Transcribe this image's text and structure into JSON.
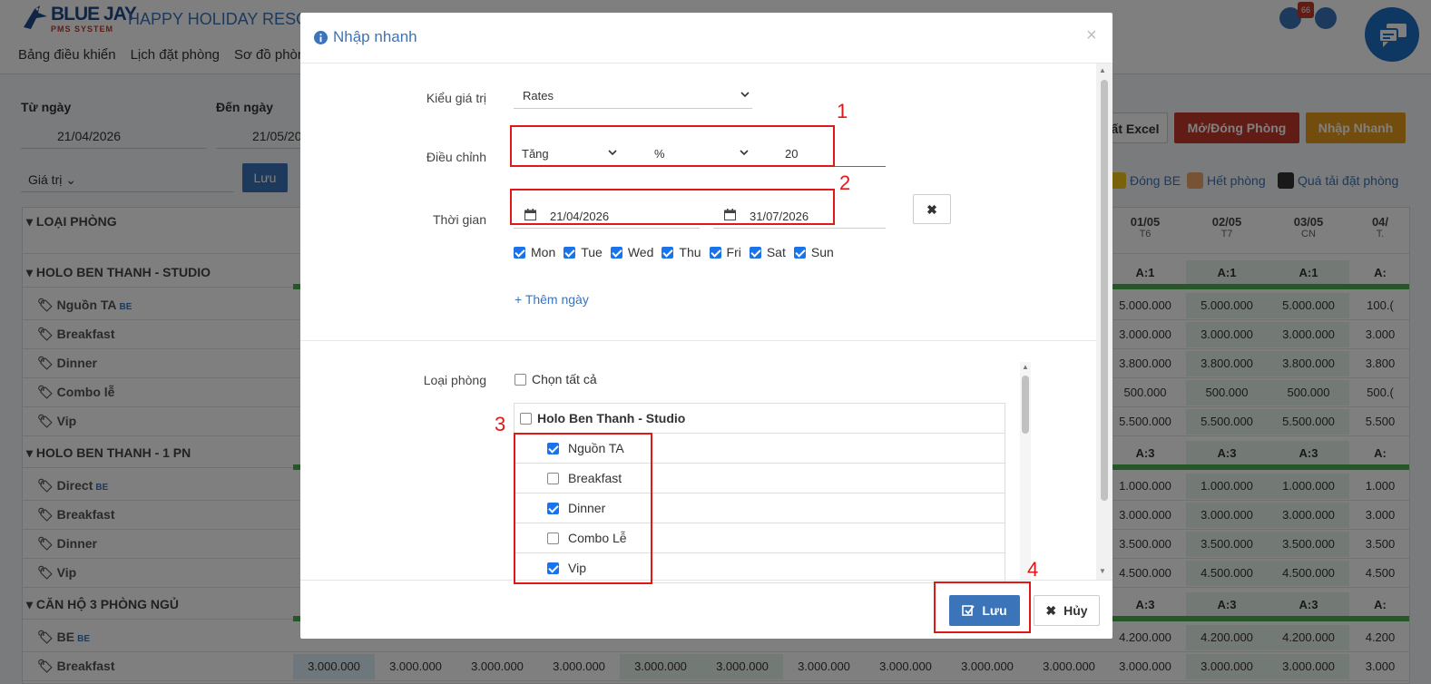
{
  "app": {
    "logo_title": "BLUE JAY",
    "logo_subtitle": "PMS SYSTEM",
    "resort_name": "HAPPY HOLIDAY RESO",
    "notification_count": "66",
    "nav": [
      "Bảng điều khiển",
      "Lịch đặt phòng",
      "Sơ đồ phòn"
    ]
  },
  "filters": {
    "from_label": "Từ ngày",
    "from_value": "21/04/2026",
    "to_label": "Đến ngày",
    "to_value": "21/05/20",
    "value_select": "Giá trị",
    "save_label": "Lưu",
    "export_label": "ất Excel",
    "open_close_label": "Mở/Đóng Phòng",
    "quick_entry_label": "Nhập Nhanh"
  },
  "legend": [
    {
      "label": "Đóng BE",
      "color": "#f0c419"
    },
    {
      "label": "Hết phòng",
      "color": "#f0a46b"
    },
    {
      "label": "Quá tải đặt phòng",
      "color": "#333333"
    }
  ],
  "grid": {
    "header_label": "LOẠI PHÒNG",
    "columns": [
      {
        "date": "01/05",
        "day": "T6"
      },
      {
        "date": "02/05",
        "day": "T7"
      },
      {
        "date": "03/05",
        "day": "CN"
      },
      {
        "date": "04/",
        "day": "T."
      }
    ],
    "rows": [
      {
        "label": "HOLO BEN THANH - STUDIO",
        "group": true,
        "cells": [
          "A:1",
          "A:1",
          "A:1",
          "A:"
        ]
      },
      {
        "label": "Nguồn TA",
        "tag": "BE",
        "cells": [
          "5.000.000",
          "5.000.000",
          "5.000.000",
          "100.("
        ]
      },
      {
        "label": "Breakfast",
        "cells": [
          "3.000.000",
          "3.000.000",
          "3.000.000",
          "3.000"
        ]
      },
      {
        "label": "Dinner",
        "cells": [
          "3.800.000",
          "3.800.000",
          "3.800.000",
          "3.800"
        ]
      },
      {
        "label": "Combo lễ",
        "cells": [
          "500.000",
          "500.000",
          "500.000",
          "500.("
        ]
      },
      {
        "label": "Vip",
        "cells": [
          "5.500.000",
          "5.500.000",
          "5.500.000",
          "5.500"
        ]
      },
      {
        "label": "HOLO BEN THANH - 1 PN",
        "group": true,
        "cells": [
          "A:3",
          "A:3",
          "A:3",
          "A:"
        ]
      },
      {
        "label": "Direct",
        "tag": "BE",
        "cells": [
          "1.000.000",
          "1.000.000",
          "1.000.000",
          "1.000"
        ]
      },
      {
        "label": "Breakfast",
        "cells": [
          "3.000.000",
          "3.000.000",
          "3.000.000",
          "3.000"
        ]
      },
      {
        "label": "Dinner",
        "cells": [
          "3.500.000",
          "3.500.000",
          "3.500.000",
          "3.500"
        ]
      },
      {
        "label": "Vip",
        "cells": [
          "4.500.000",
          "4.500.000",
          "4.500.000",
          "4.500"
        ]
      },
      {
        "label": "CĂN HỘ 3 PHÒNG NGỦ",
        "group": true,
        "cells": [
          "A:3",
          "A:3",
          "A:3",
          "A:"
        ]
      },
      {
        "label": "BE",
        "tag": "BE",
        "cells": [
          "4.200.000",
          "4.200.000",
          "4.200.000",
          "4.200"
        ]
      },
      {
        "label": "Breakfast",
        "cells": [
          "3.000.000",
          "3.000.000",
          "3.000.000",
          "3.000"
        ]
      }
    ],
    "bottom_row_cells": [
      "3.000.000",
      "3.000.000",
      "3.000.000",
      "3.000.000",
      "3.000.000",
      "3.000.000",
      "3.000.000",
      "3.000.000",
      "3.000.000",
      "3.000.000"
    ]
  },
  "modal": {
    "title": "Nhập nhanh",
    "value_type_label": "Kiểu giá trị",
    "value_type": "Rates",
    "adjust_label": "Điều chỉnh",
    "adjust_direction": "Tăng",
    "adjust_unit": "%",
    "adjust_amount": "20",
    "time_label": "Thời gian",
    "date_from": "21/04/2026",
    "date_to": "31/07/2026",
    "days": [
      {
        "label": "Mon",
        "checked": true
      },
      {
        "label": "Tue",
        "checked": true
      },
      {
        "label": "Wed",
        "checked": true
      },
      {
        "label": "Thu",
        "checked": true
      },
      {
        "label": "Fri",
        "checked": true
      },
      {
        "label": "Sat",
        "checked": true
      },
      {
        "label": "Sun",
        "checked": true
      }
    ],
    "add_day": "+ Thêm ngày",
    "room_type_label": "Loại phòng",
    "select_all": "Chọn tất cả",
    "room_group": "Holo Ben Thanh - Studio",
    "rates": [
      {
        "label": "Nguồn TA",
        "checked": true
      },
      {
        "label": "Breakfast",
        "checked": false
      },
      {
        "label": "Dinner",
        "checked": true
      },
      {
        "label": "Combo Lễ",
        "checked": false
      },
      {
        "label": "Vip",
        "checked": true
      }
    ],
    "save_label": "Lưu",
    "cancel_label": "Hủy"
  },
  "annotations": [
    "1",
    "2",
    "3",
    "4"
  ]
}
